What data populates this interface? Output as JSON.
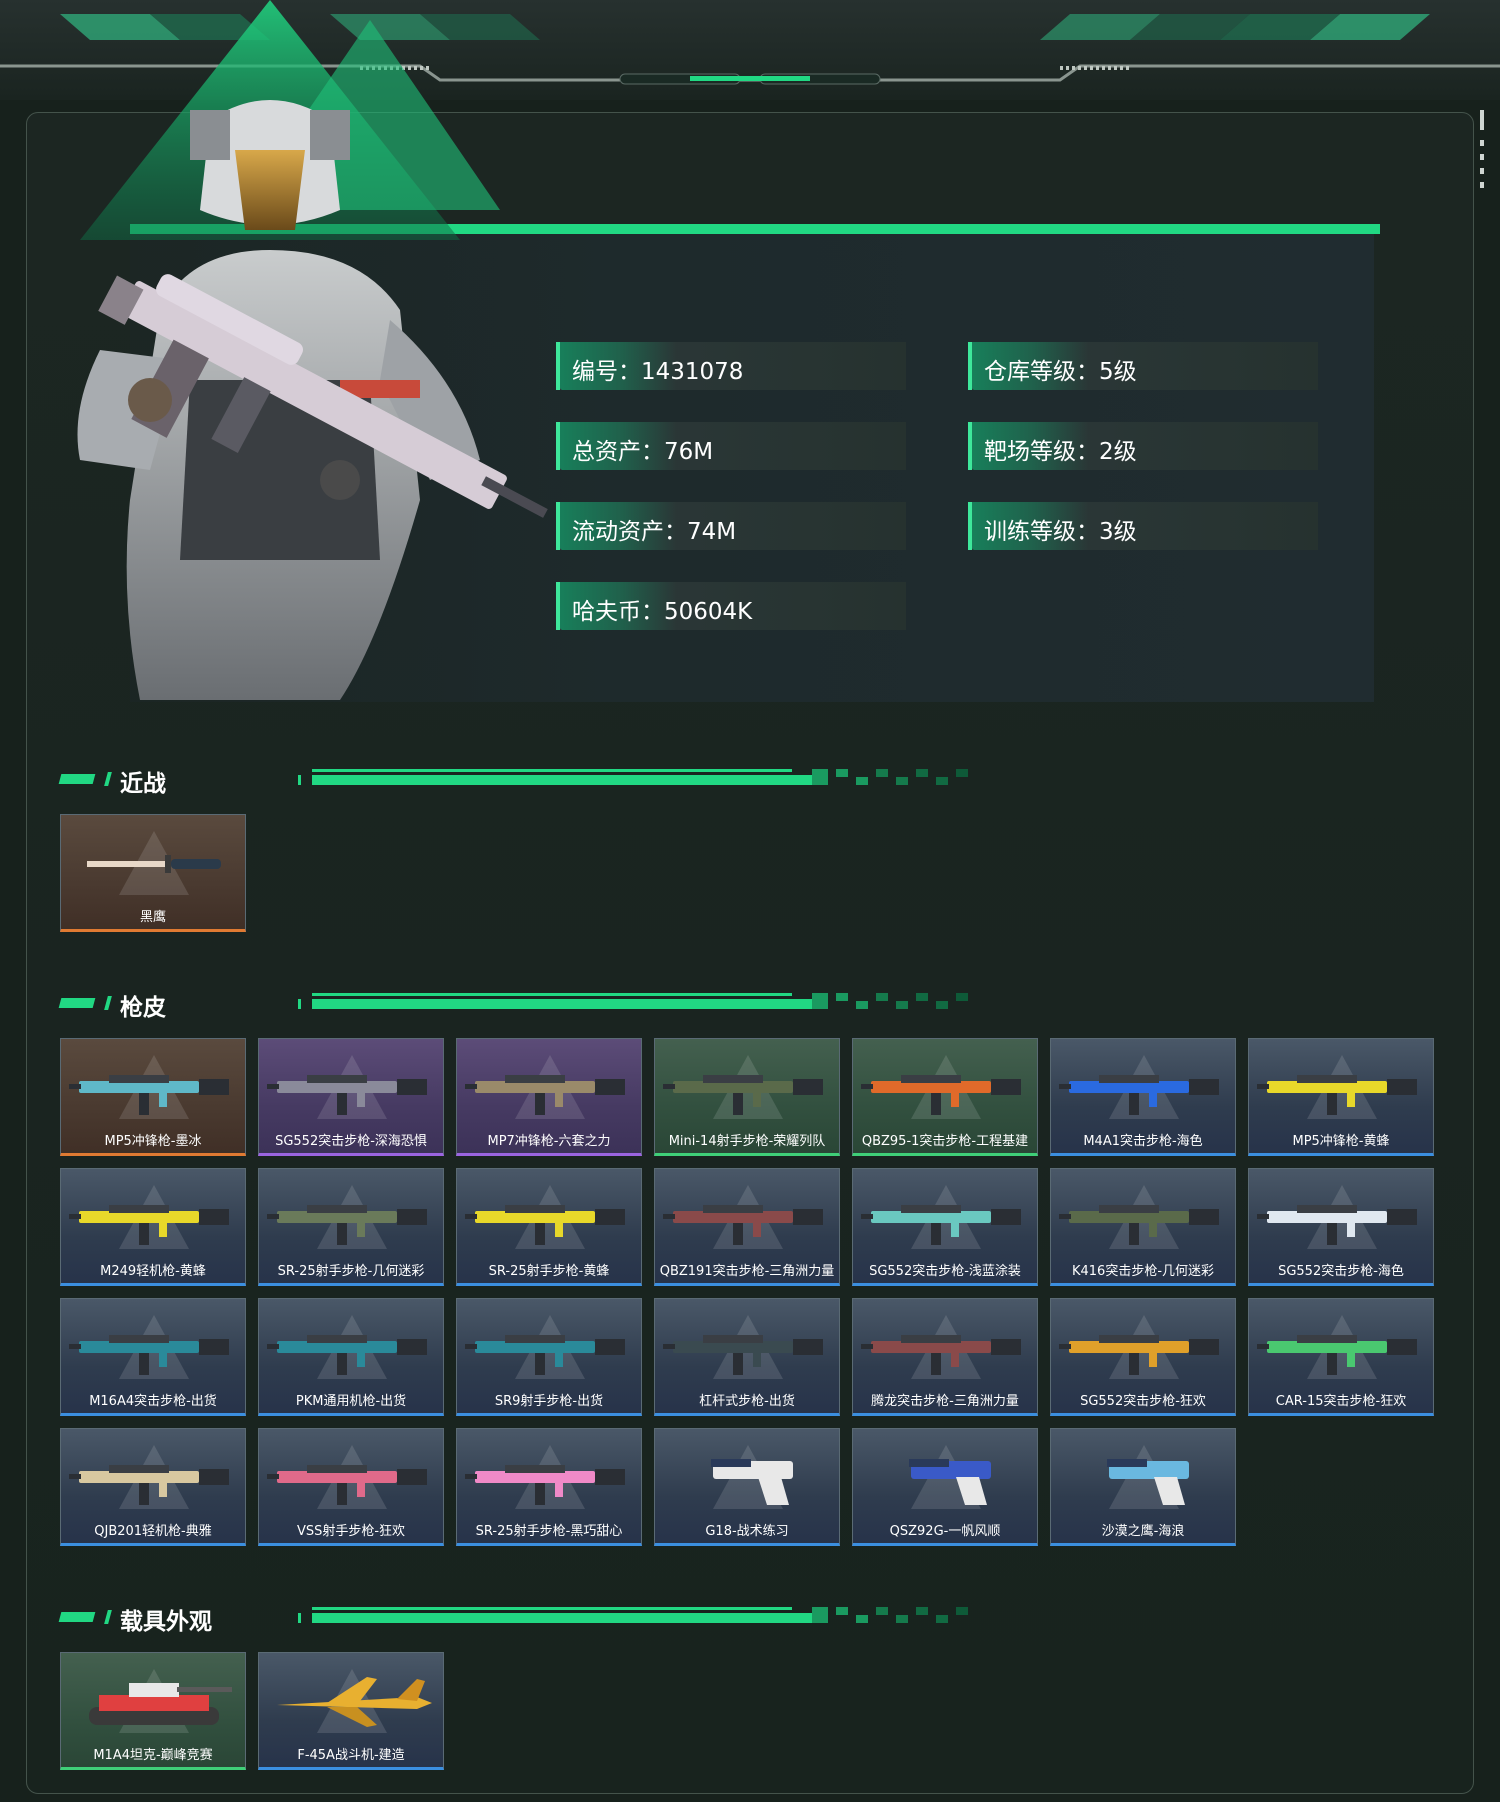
{
  "profile": {
    "stats": [
      {
        "label": "编号：1431078"
      },
      {
        "label": "仓库等级：5级"
      },
      {
        "label": "总资产：76M"
      },
      {
        "label": "靶场等级：2级"
      },
      {
        "label": "流动资产：74M"
      },
      {
        "label": "训练等级：3级"
      },
      {
        "label": "哈夫币：50604K"
      }
    ]
  },
  "sections": {
    "melee": {
      "title": "近战",
      "items": [
        {
          "name": "黑鹰",
          "rarity": "orange",
          "color": "#e07a32"
        }
      ]
    },
    "gun_skins": {
      "title": "枪皮",
      "items": [
        {
          "name": "MP5冲锋枪-墨冰",
          "rarity": "orange",
          "color": "#5fb8c8"
        },
        {
          "name": "SG552突击步枪-深海恐惧",
          "rarity": "purple",
          "color": "#8a8a9a"
        },
        {
          "name": "MP7冲锋枪-六套之力",
          "rarity": "purple",
          "color": "#9a8a6a"
        },
        {
          "name": "Mini-14射手步枪-荣耀列队",
          "rarity": "green",
          "color": "#5a6a4a"
        },
        {
          "name": "QBZ95-1突击步枪-工程基建",
          "rarity": "green",
          "color": "#e06a2a"
        },
        {
          "name": "M4A1突击步枪-海色",
          "rarity": "blue",
          "color": "#2a6ae0"
        },
        {
          "name": "MP5冲锋枪-黄蜂",
          "rarity": "blue",
          "color": "#e8d82a"
        },
        {
          "name": "M249轻机枪-黄蜂",
          "rarity": "blue",
          "color": "#e8d82a"
        },
        {
          "name": "SR-25射手步枪-几何迷彩",
          "rarity": "blue",
          "color": "#6a7a5a"
        },
        {
          "name": "SR-25射手步枪-黄蜂",
          "rarity": "blue",
          "color": "#e8d82a"
        },
        {
          "name": "QBZ191突击步枪-三角洲力量",
          "rarity": "blue",
          "color": "#8a4a4a"
        },
        {
          "name": "SG552突击步枪-浅蓝涂装",
          "rarity": "blue",
          "color": "#6ac8c0"
        },
        {
          "name": "K416突击步枪-几何迷彩",
          "rarity": "blue",
          "color": "#5a6a4a"
        },
        {
          "name": "SG552突击步枪-海色",
          "rarity": "blue",
          "color": "#e0e8f0"
        },
        {
          "name": "M16A4突击步枪-出货",
          "rarity": "blue",
          "color": "#2a8a9a"
        },
        {
          "name": "PKM通用机枪-出货",
          "rarity": "blue",
          "color": "#2a8a9a"
        },
        {
          "name": "SR9射手步枪-出货",
          "rarity": "blue",
          "color": "#2a8a9a"
        },
        {
          "name": "杠杆式步枪-出货",
          "rarity": "blue",
          "color": "#3a4a50"
        },
        {
          "name": "腾龙突击步枪-三角洲力量",
          "rarity": "blue",
          "color": "#8a4a4a"
        },
        {
          "name": "SG552突击步枪-狂欢",
          "rarity": "blue",
          "color": "#e0a02a"
        },
        {
          "name": "CAR-15突击步枪-狂欢",
          "rarity": "blue",
          "color": "#4ac870"
        },
        {
          "name": "QJB201轻机枪-典雅",
          "rarity": "blue",
          "color": "#d8c8a0"
        },
        {
          "name": "VSS射手步枪-狂欢",
          "rarity": "blue",
          "color": "#e06a8a"
        },
        {
          "name": "SR-25射手步枪-黑巧甜心",
          "rarity": "blue",
          "color": "#f08ac8"
        },
        {
          "name": "G18-战术练习",
          "rarity": "blue",
          "color": "#e8e8e8"
        },
        {
          "name": "QSZ92G-一帆风顺",
          "rarity": "blue",
          "color": "#3a5ac8"
        },
        {
          "name": "沙漠之鹰-海浪",
          "rarity": "blue",
          "color": "#6ab8e0"
        }
      ]
    },
    "vehicles": {
      "title": "载具外观",
      "items": [
        {
          "name": "M1A4坦克-巅峰竞赛",
          "rarity": "green",
          "color": "#e04040"
        },
        {
          "name": "F-45A战斗机-建造",
          "rarity": "blue",
          "color": "#e8b030"
        }
      ]
    }
  }
}
